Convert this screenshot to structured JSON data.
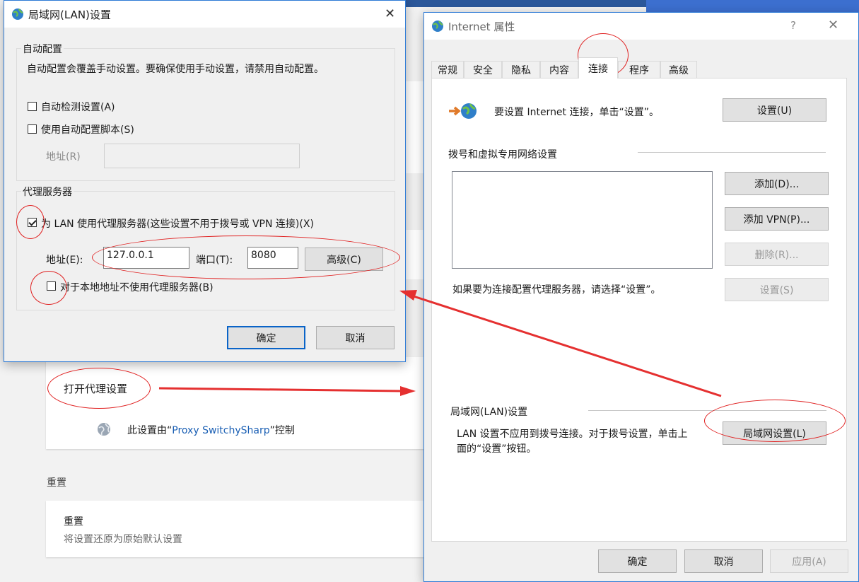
{
  "background": {
    "open_proxy_label": "打开代理设置",
    "controlled_prefix": "此设置由“",
    "controlled_ext": "Proxy SwitchySharp",
    "controlled_suffix": "”控制",
    "reset_heading": "重置",
    "reset_title": "重置",
    "reset_desc": "将设置还原为原始默认设置"
  },
  "lan_dialog": {
    "title": "局域网(LAN)设置",
    "auto_group_label": "自动配置",
    "auto_desc": "自动配置会覆盖手动设置。要确保使用手动设置，请禁用自动配置。",
    "auto_detect_label": "自动检测设置(A)",
    "auto_detect_checked": false,
    "auto_script_label": "使用自动配置脚本(S)",
    "auto_script_checked": false,
    "address_label": "地址(R)",
    "address_value": "",
    "proxy_group_label": "代理服务器",
    "use_proxy_label": "为 LAN 使用代理服务器(这些设置不用于拨号或 VPN 连接)(X)",
    "use_proxy_checked": true,
    "proxy_address_label": "地址(E):",
    "proxy_address_value": "127.0.0.1",
    "port_label": "端口(T):",
    "port_value": "8080",
    "advanced_button": "高级(C)",
    "bypass_local_label": "对于本地地址不使用代理服务器(B)",
    "bypass_local_checked": false,
    "ok_button": "确定",
    "cancel_button": "取消"
  },
  "inet_dialog": {
    "title": "Internet 属性",
    "help": "?",
    "tabs": [
      "常规",
      "安全",
      "隐私",
      "内容",
      "连接",
      "程序",
      "高级"
    ],
    "active_tab": "连接",
    "setup_text": "要设置 Internet 连接，单击“设置”。",
    "setup_button": "设置(U)",
    "dialup_heading": "拨号和虚拟专用网络设置",
    "add_button": "添加(D)...",
    "add_vpn_button": "添加 VPN(P)...",
    "remove_button": "删除(R)...",
    "settings_button": "设置(S)",
    "proxy_hint": "如果要为连接配置代理服务器，请选择“设置”。",
    "lan_heading": "局域网(LAN)设置",
    "lan_desc_line1": "LAN 设置不应用到拨号连接。对于拨号设置，单击上",
    "lan_desc_line2": "面的“设置”按钮。",
    "lan_button": "局域网设置(L)",
    "ok_button": "确定",
    "cancel_button": "取消",
    "apply_button": "应用(A)"
  },
  "colors": {
    "annotation": "#e02020",
    "accent": "#0a64c8"
  }
}
